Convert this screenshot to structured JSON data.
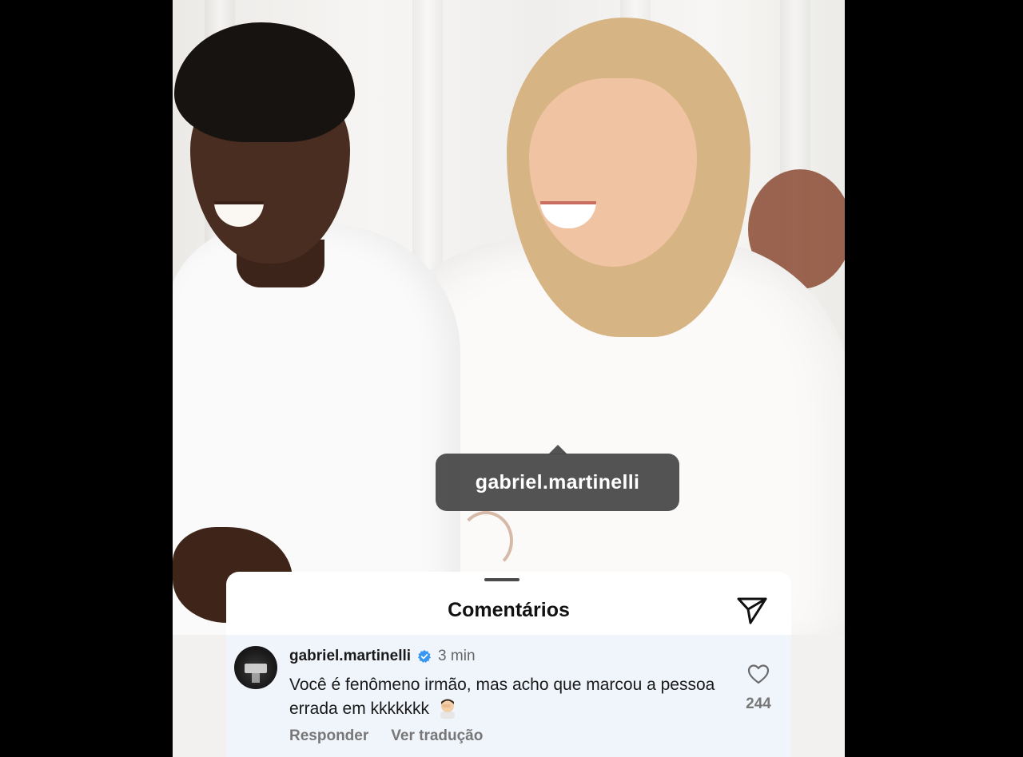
{
  "tag": {
    "username": "gabriel.martinelli"
  },
  "sheet": {
    "title": "Comentários"
  },
  "comment": {
    "username": "gabriel.martinelli",
    "time": "3 min",
    "text": "Você é fenômeno irmão, mas acho que marcou a pessoa errada em kkkkkkk",
    "reply_label": "Responder",
    "translate_label": "Ver tradução",
    "like_count": "244"
  },
  "icons": {
    "share": "paper-plane-icon",
    "verified": "verified-badge-icon",
    "like": "heart-icon",
    "emoji": "man-facepalm-emoji"
  },
  "colors": {
    "verified": "#3897f0",
    "comment_bg": "#f0f5fc",
    "tag_bg": "#464646"
  }
}
